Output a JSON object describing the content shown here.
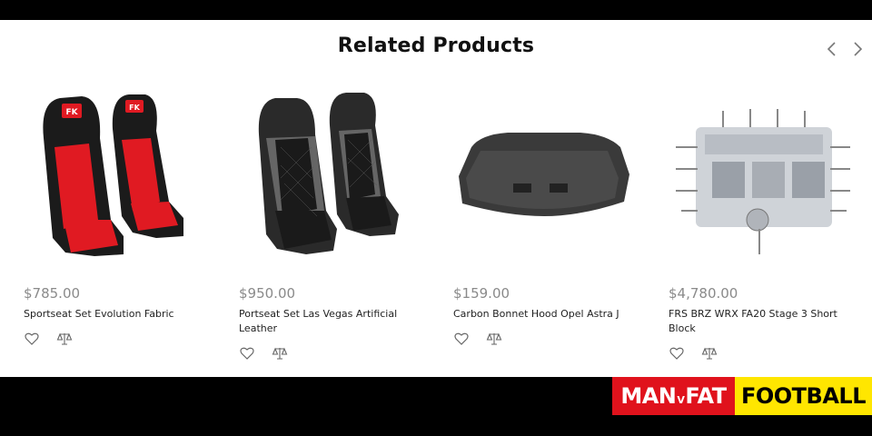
{
  "section": {
    "title": "Related Products"
  },
  "nav": {
    "prev_icon": "chevron-left-icon",
    "next_icon": "chevron-right-icon"
  },
  "products": [
    {
      "price": "$785.00",
      "name": "Sportseat Set Evolution Fabric",
      "image": "red-black-racing-seats",
      "badge": "FK"
    },
    {
      "price": "$950.00",
      "name": "Portseat Set Las Vegas Artificial Leather",
      "image": "black-grey-quilted-seats"
    },
    {
      "price": "$159.00",
      "name": "Carbon Bonnet Hood Opel Astra J",
      "image": "carbon-bonnet-hood"
    },
    {
      "price": "$4,780.00",
      "name": "FRS BRZ WRX FA20 Stage 3 Short Block",
      "image": "engine-short-block"
    }
  ],
  "actions": {
    "wishlist_icon": "heart-icon",
    "compare_icon": "scale-icon"
  },
  "watermark": {
    "part1a": "MAN",
    "part1b": "V",
    "part1c": "FAT",
    "part2": "FOOTBALL"
  },
  "colors": {
    "price": "#8a8a8a",
    "logo_red": "#e0121c",
    "logo_yellow": "#ffe600"
  }
}
